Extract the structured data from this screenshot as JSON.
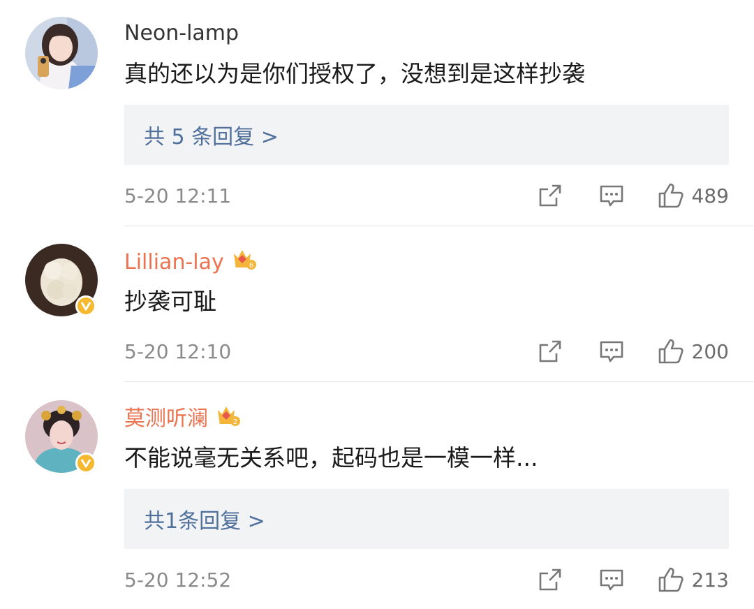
{
  "comments": [
    {
      "username": "Neon-lamp",
      "text": "真的还以为是你们授权了，没想到是这样抄袭",
      "replies_label": "共 5 条回复 >",
      "time": "5-20 12:11",
      "likes": "489",
      "avatar_icon": "girl-selfie-avatar"
    },
    {
      "username": "Lillian-lay",
      "text": "抄袭可耻",
      "time": "5-20 12:10",
      "likes": "200",
      "avatar_icon": "white-stone-avatar",
      "crown_level": "6"
    },
    {
      "username": "莫测听澜",
      "text": "不能说毫无关系吧，起码也是一模一样...",
      "replies_label": "共1条回复 >",
      "time": "5-20 12:52",
      "likes": "213",
      "avatar_icon": "costume-actress-avatar",
      "crown_level": "2"
    }
  ],
  "colors": {
    "vip_name": "#eb7350",
    "reply_link": "#50709c",
    "reply_bg": "#f2f3f5",
    "verified_badge": "#f5b82e"
  }
}
